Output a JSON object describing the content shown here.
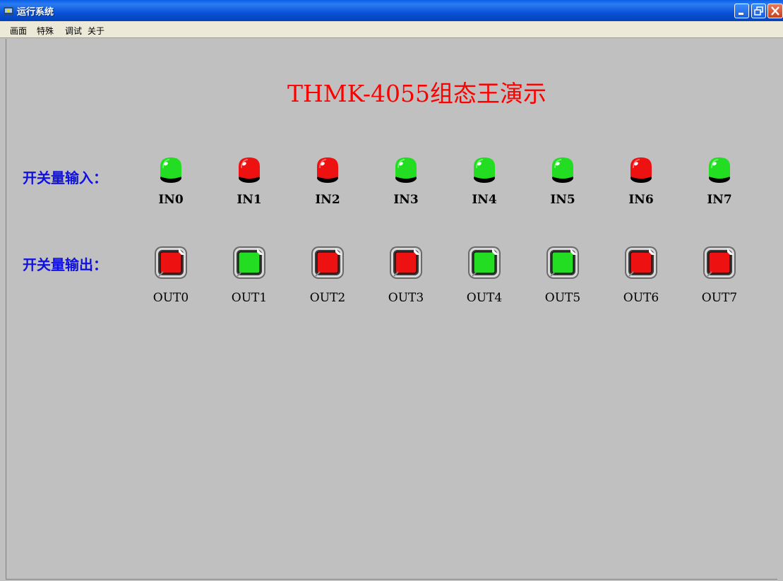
{
  "window": {
    "title": "运行系统"
  },
  "menu": [
    "画面",
    "特殊",
    "调试",
    "关于"
  ],
  "main": {
    "title": "THMK-4055组态王演示",
    "inputs_label": "开关量输入：",
    "outputs_label": "开关量输出：",
    "inputs": [
      {
        "name": "IN0",
        "state": "on"
      },
      {
        "name": "IN1",
        "state": "off"
      },
      {
        "name": "IN2",
        "state": "off"
      },
      {
        "name": "IN3",
        "state": "on"
      },
      {
        "name": "IN4",
        "state": "on"
      },
      {
        "name": "IN5",
        "state": "on"
      },
      {
        "name": "IN6",
        "state": "off"
      },
      {
        "name": "IN7",
        "state": "on"
      }
    ],
    "outputs": [
      {
        "name": "OUT0",
        "state": "off"
      },
      {
        "name": "OUT1",
        "state": "on"
      },
      {
        "name": "OUT2",
        "state": "off"
      },
      {
        "name": "OUT3",
        "state": "off"
      },
      {
        "name": "OUT4",
        "state": "on"
      },
      {
        "name": "OUT5",
        "state": "on"
      },
      {
        "name": "OUT6",
        "state": "off"
      },
      {
        "name": "OUT7",
        "state": "off"
      }
    ]
  },
  "colors": {
    "on": "#22dd22",
    "off": "#ee1111",
    "label_blue": "#1010e0",
    "title_red": "#ff0000"
  }
}
